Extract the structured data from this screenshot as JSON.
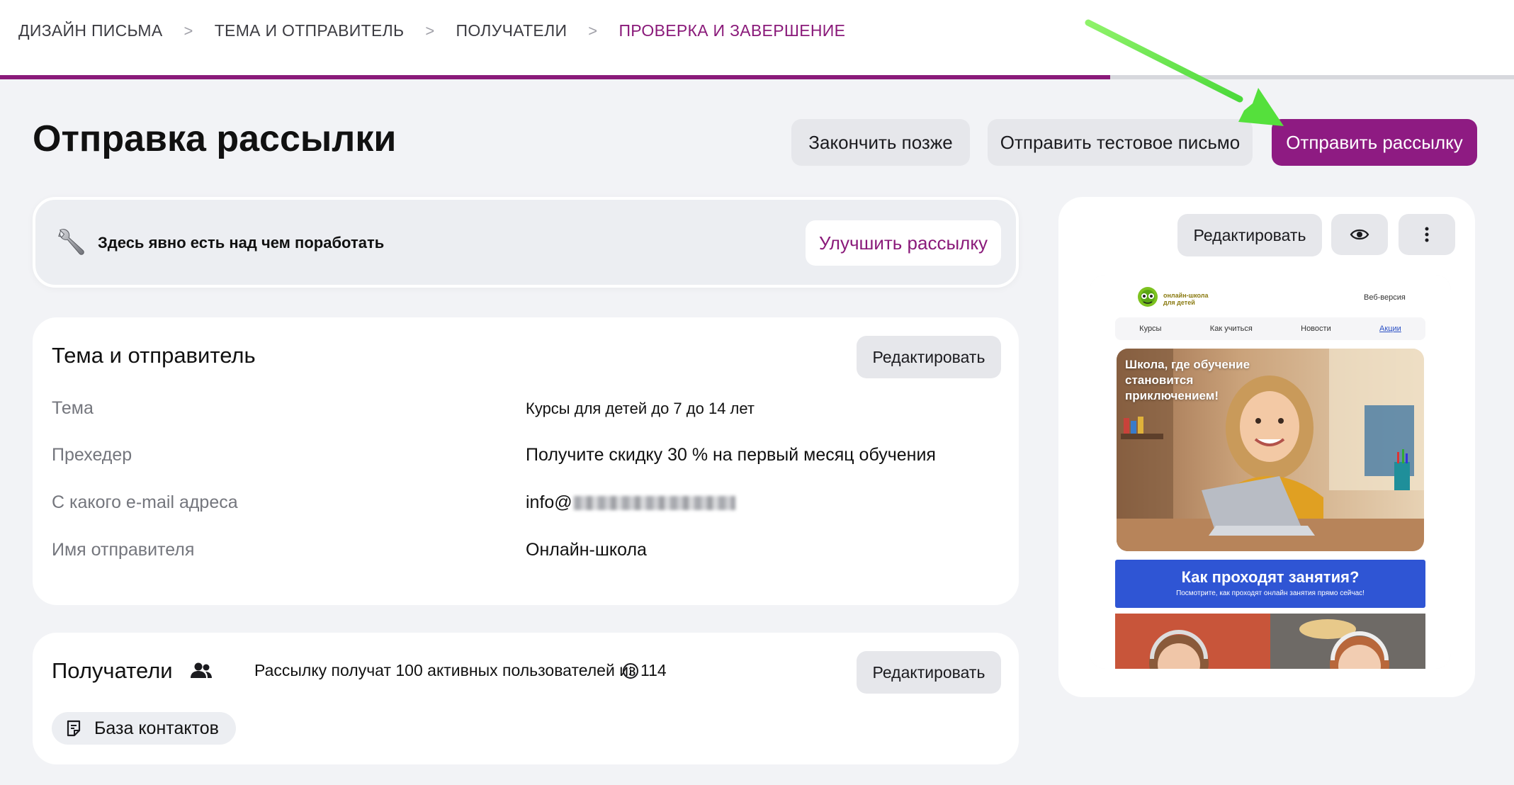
{
  "breadcrumbs": [
    {
      "label": "ДИЗАЙН ПИСЬМА",
      "active": false
    },
    {
      "label": "ТЕМА И ОТПРАВИТЕЛЬ",
      "active": false
    },
    {
      "label": "ПОЛУЧАТЕЛИ",
      "active": false
    },
    {
      "label": "ПРОВЕРКА И ЗАВЕРШЕНИЕ",
      "active": true
    }
  ],
  "breadcrumb_separator": ">",
  "progress": {
    "fraction": 0.75
  },
  "header": {
    "title": "Отправка рассылки",
    "finish_later_label": "Закончить позже",
    "send_test_label": "Отправить тестовое письмо",
    "send_label": "Отправить рассылку"
  },
  "hint": {
    "icon": "wrench-icon",
    "text": "Здесь явно есть над чем поработать",
    "improve_label": "Улучшить рассылку"
  },
  "subject_sender": {
    "title": "Тема и отправитель",
    "edit_label": "Редактировать",
    "fields": [
      {
        "label": "Тема",
        "value": "Курсы для детей до 7 до 14 лет"
      },
      {
        "label": "Прехедер",
        "value": "Получите скидку 30 % на первый месяц обучения"
      },
      {
        "label": "С какого e-mail адреса",
        "value": "info@"
      },
      {
        "label": "Имя отправителя",
        "value": "Онлайн-школа"
      }
    ]
  },
  "recipients": {
    "title": "Получатели",
    "icon": "users-icon",
    "summary": "Рассылку получат 100 активных пользователей из 114",
    "edit_label": "Редактировать",
    "contact_base_label": "База контактов"
  },
  "preview": {
    "edit_label": "Редактировать",
    "eye_icon": "eye-icon",
    "more_icon": "more-vertical-icon",
    "email": {
      "logo_text_line1": "онлайн-школа",
      "logo_text_line2": "для детей",
      "web_version": "Веб-версия",
      "nav": [
        "Курсы",
        "Как учиться",
        "Новости",
        "Акции"
      ],
      "hero_text": "Школа, где обучение становится приключением!",
      "banner_title": "Как проходят занятия?",
      "banner_subtitle": "Посмотрите, как проходят онлайн занятия прямо сейчас!"
    }
  },
  "colors": {
    "accent": "#8e1b82",
    "background": "#f2f3f6",
    "card": "#ffffff",
    "banner_blue": "#2f55d4"
  }
}
